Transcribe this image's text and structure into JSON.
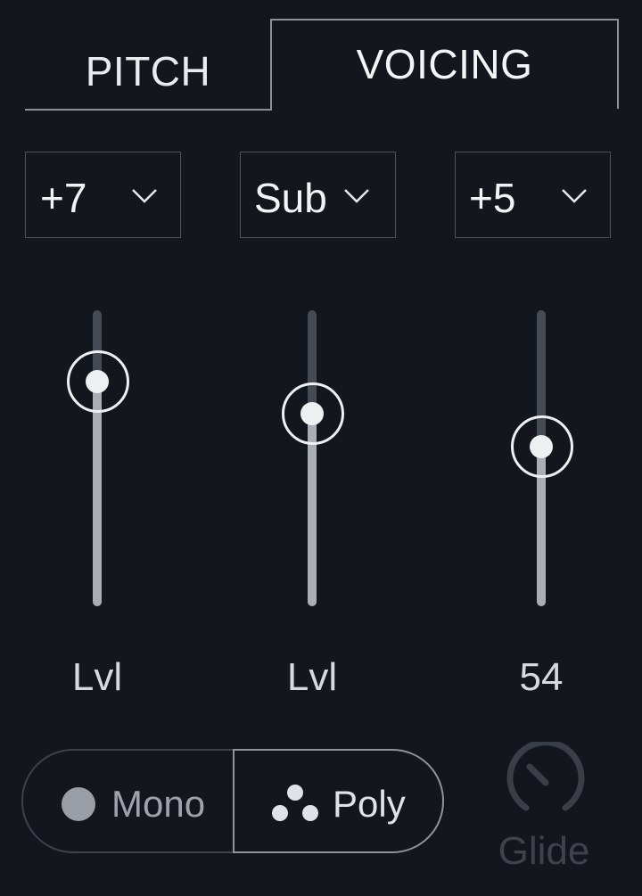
{
  "tabs": {
    "pitch_label": "PITCH",
    "voicing_label": "VOICING",
    "active": "VOICING"
  },
  "dropdowns": [
    {
      "value": "+7"
    },
    {
      "value": "Sub"
    },
    {
      "value": "+5"
    }
  ],
  "sliders": [
    {
      "label": "Lvl",
      "level": 0.76
    },
    {
      "label": "Lvl",
      "level": 0.65
    },
    {
      "label": "54",
      "level": 0.54
    }
  ],
  "mode": {
    "mono_label": "Mono",
    "poly_label": "Poly",
    "selected": "Poly"
  },
  "glide": {
    "label": "Glide",
    "enabled": false
  },
  "icons": {
    "dropdown": "chevron-down-icon",
    "mono": "dot-icon",
    "poly": "three-dots-icon",
    "glide": "knob-icon"
  },
  "colors": {
    "background": "#14161d",
    "text": "#f2f3f5",
    "track": "#454b55",
    "track_fill": "#a9adb5",
    "disabled": "#3e434b"
  }
}
